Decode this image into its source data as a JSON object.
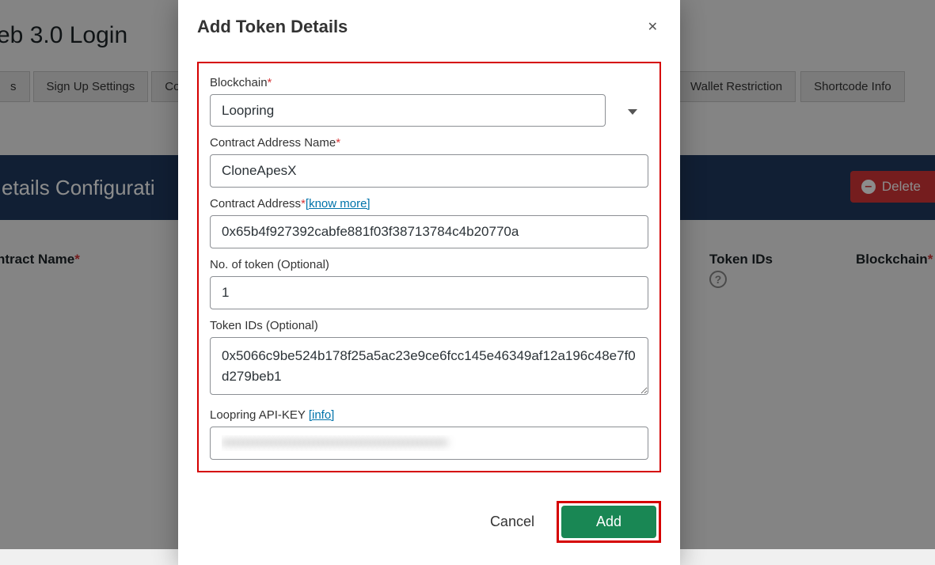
{
  "page": {
    "title": "eb 3.0 Login",
    "tabs_left": [
      "s",
      "Sign Up Settings",
      "Co"
    ],
    "tabs_right": [
      "Wallet Restriction",
      "Shortcode Info"
    ],
    "config_banner": "etails Configurati",
    "delete_label": "Delete",
    "columns": {
      "contract_name": "ntract Name",
      "token_ids": "Token IDs",
      "blockchain": "Blockchain"
    }
  },
  "modal": {
    "title": "Add Token Details",
    "labels": {
      "blockchain": "Blockchain",
      "contract_name": "Contract Address Name",
      "contract_address": "Contract Address",
      "know_more": "[know more]",
      "num_token": "No. of token (Optional)",
      "token_ids": "Token IDs (Optional)",
      "api_key": "Loopring API-KEY",
      "info": "[info]"
    },
    "values": {
      "blockchain": "Loopring",
      "contract_name": "CloneApesX",
      "contract_address": "0x65b4f927392cabfe881f03f38713784c4b20770a",
      "num_token": "1",
      "token_ids": "0x5066c9be524b178f25a5ac23e9ce6fcc145e46349af12a196c48e7f0d279beb1",
      "api_key": "••••••••••••••••••••••••••••••••••••••••••••••••"
    },
    "buttons": {
      "cancel": "Cancel",
      "add": "Add"
    }
  }
}
